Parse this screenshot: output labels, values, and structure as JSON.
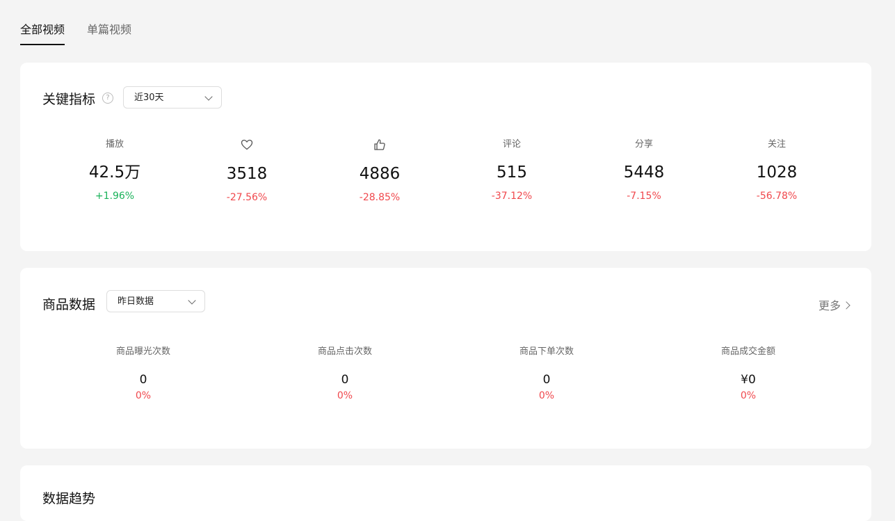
{
  "tabs": [
    {
      "label": "全部视频",
      "active": true
    },
    {
      "label": "单篇视频",
      "active": false
    }
  ],
  "key_metrics": {
    "title": "关键指标",
    "period_select": "近30天",
    "metrics": [
      {
        "label": "播放",
        "icon": null,
        "value": "42.5万",
        "change": "+1.96%",
        "trend": "up"
      },
      {
        "label": "",
        "icon": "heart-icon",
        "value": "3518",
        "change": "-27.56%",
        "trend": "down"
      },
      {
        "label": "",
        "icon": "thumbs-up-icon",
        "value": "4886",
        "change": "-28.85%",
        "trend": "down"
      },
      {
        "label": "评论",
        "icon": null,
        "value": "515",
        "change": "-37.12%",
        "trend": "down"
      },
      {
        "label": "分享",
        "icon": null,
        "value": "5448",
        "change": "-7.15%",
        "trend": "down"
      },
      {
        "label": "关注",
        "icon": null,
        "value": "1028",
        "change": "-56.78%",
        "trend": "down"
      }
    ]
  },
  "goods_data": {
    "title": "商品数据",
    "period_select": "昨日数据",
    "more_label": "更多",
    "metrics": [
      {
        "label": "商品曝光次数",
        "value": "0",
        "change": "0%"
      },
      {
        "label": "商品点击次数",
        "value": "0",
        "change": "0%"
      },
      {
        "label": "商品下单次数",
        "value": "0",
        "change": "0%"
      },
      {
        "label": "商品成交金额",
        "value": "¥0",
        "change": "0%"
      }
    ]
  },
  "data_trend": {
    "title": "数据趋势"
  },
  "colors": {
    "up": "#1ab25a",
    "down": "#f0484d",
    "background": "#f4f4f4"
  }
}
